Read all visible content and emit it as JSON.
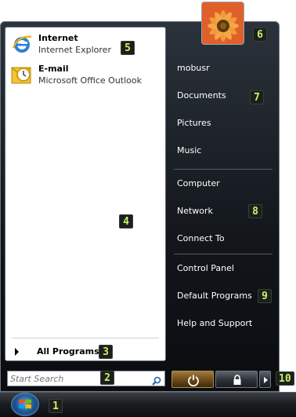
{
  "pinned": [
    {
      "title": "Internet",
      "subtitle": "Internet Explorer",
      "icon": "internet-explorer-icon"
    },
    {
      "title": "E-mail",
      "subtitle": "Microsoft Office Outlook",
      "icon": "outlook-icon"
    }
  ],
  "all_programs_label": "All Programs",
  "search": {
    "placeholder": "Start Search",
    "icon": "search-icon"
  },
  "user": {
    "name": "mobusr",
    "picture": "user-flower-picture"
  },
  "right_links": {
    "documents": "Documents",
    "pictures": "Pictures",
    "music": "Music",
    "computer": "Computer",
    "network": "Network",
    "connect_to": "Connect To",
    "control_panel": "Control Panel",
    "default_programs": "Default Programs",
    "help_and_support": "Help and Support"
  },
  "power_buttons": [
    {
      "icon": "power-icon"
    },
    {
      "icon": "lock-icon"
    },
    {
      "icon": "arrow-right-icon"
    }
  ],
  "callouts": {
    "c1": "1",
    "c2": "2",
    "c3": "3",
    "c4": "4",
    "c5": "5",
    "c6": "6",
    "c7": "7",
    "c8": "8",
    "c9": "9",
    "c10": "10"
  },
  "colors": {
    "callout_text": "#c6f56a",
    "menu_dark": "#12161b",
    "taskbar": "#1b1e22"
  }
}
